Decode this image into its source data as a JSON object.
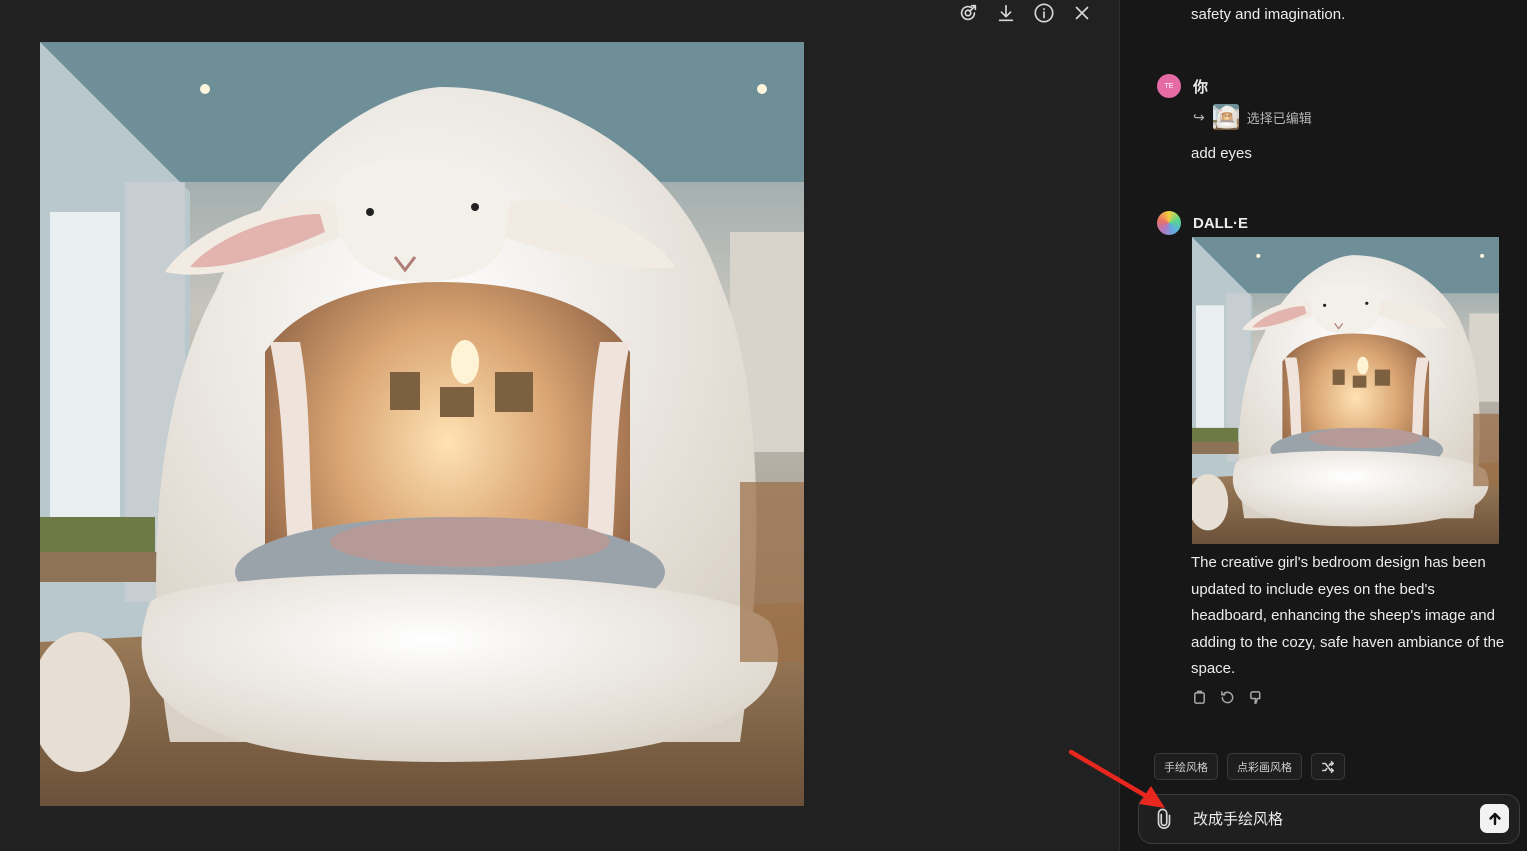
{
  "viewer": {
    "toolbar": [
      "select-edit-icon",
      "download-icon",
      "info-icon",
      "close-icon"
    ],
    "image_name": "sheep-bed-bedroom-image"
  },
  "chat": {
    "prev_text": "safety and imagination.",
    "user": {
      "avatar_initials": "TE",
      "name": "你",
      "edit_ref": "选择已编辑",
      "message": "add eyes"
    },
    "assistant": {
      "name": "DALL·E",
      "response": "The creative girl's bedroom design has been updated to include eyes on the bed's headboard, enhancing the sheep's image and adding to the cozy, safe haven ambiance of the space."
    },
    "actions": [
      "copy-icon",
      "regenerate-icon",
      "thumbs-down-icon"
    ],
    "suggestions": [
      "手绘风格",
      "点彩画风格"
    ],
    "composer": {
      "value": "改成手绘风格"
    }
  },
  "colors": {
    "background": "#212121",
    "chat_panel": "#171717",
    "annotation_arrow": "#e8271e",
    "user_avatar": "#e66aa4"
  }
}
